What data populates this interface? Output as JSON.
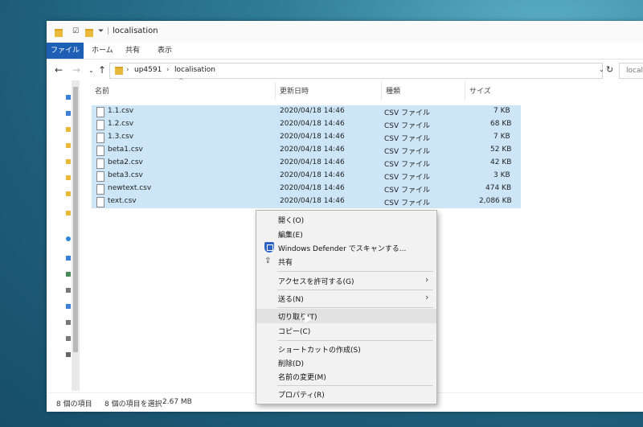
{
  "window": {
    "title": "localisation",
    "ribbon_tabs": [
      "ファイル",
      "ホーム",
      "共有",
      "表示"
    ],
    "breadcrumb": [
      "up4591",
      "localisation"
    ],
    "search_value": "locali"
  },
  "columns": {
    "name": "名前",
    "modified": "更新日時",
    "type": "種類",
    "size": "サイズ"
  },
  "files": [
    {
      "name": "1.1.csv",
      "modified": "2020/04/18 14:46",
      "type": "CSV ファイル",
      "size": "7 KB"
    },
    {
      "name": "1.2.csv",
      "modified": "2020/04/18 14:46",
      "type": "CSV ファイル",
      "size": "68 KB"
    },
    {
      "name": "1.3.csv",
      "modified": "2020/04/18 14:46",
      "type": "CSV ファイル",
      "size": "7 KB"
    },
    {
      "name": "beta1.csv",
      "modified": "2020/04/18 14:46",
      "type": "CSV ファイル",
      "size": "52 KB"
    },
    {
      "name": "beta2.csv",
      "modified": "2020/04/18 14:46",
      "type": "CSV ファイル",
      "size": "42 KB"
    },
    {
      "name": "beta3.csv",
      "modified": "2020/04/18 14:46",
      "type": "CSV ファイル",
      "size": "3 KB"
    },
    {
      "name": "newtext.csv",
      "modified": "2020/04/18 14:46",
      "type": "CSV ファイル",
      "size": "474 KB"
    },
    {
      "name": "text.csv",
      "modified": "2020/04/18 14:46",
      "type": "CSV ファイル",
      "size": "2,086 KB"
    }
  ],
  "status": {
    "count": "8 個の項目",
    "selected": "8 個の項目を選択",
    "size": "2.67 MB"
  },
  "context_menu": {
    "open": "開く(O)",
    "edit": "編集(E)",
    "defender": "Windows Defender でスキャンする...",
    "share": "共有",
    "give_access": "アクセスを許可する(G)",
    "send_to": "送る(N)",
    "cut": "切り取り(T)",
    "copy": "コピー(C)",
    "shortcut": "ショートカットの作成(S)",
    "delete": "削除(D)",
    "rename": "名前の変更(M)",
    "properties": "プロパティ(R)"
  },
  "colors": {
    "selection": "#cde6f7",
    "file_tab": "#1c5fb4",
    "menu_bg": "#f2f2f2"
  }
}
